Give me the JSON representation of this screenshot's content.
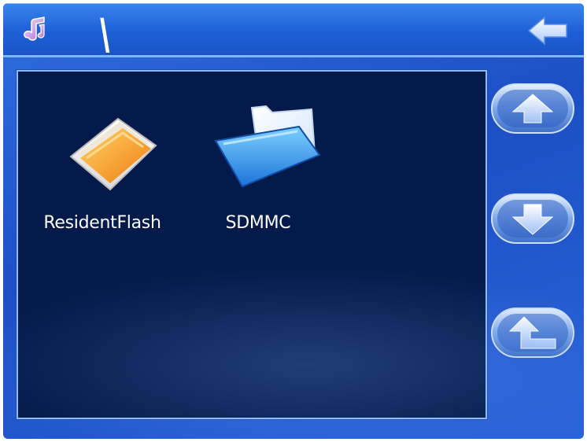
{
  "header": {
    "path_separator": "\\",
    "icons": {
      "left": "music-note-icon",
      "right": "back-arrow-icon"
    }
  },
  "files": {
    "items": [
      {
        "label": "ResidentFlash",
        "icon": "flash-folder-icon",
        "color": "#f59a1c"
      },
      {
        "label": "SDMMC",
        "icon": "sd-folder-icon",
        "color": "#3aa0f0"
      }
    ]
  },
  "sidebar": {
    "buttons": [
      {
        "name": "scroll-up",
        "icon": "arrow-up-icon"
      },
      {
        "name": "scroll-down",
        "icon": "arrow-down-icon"
      },
      {
        "name": "parent-directory",
        "icon": "return-up-icon"
      }
    ]
  },
  "colors": {
    "frame": "#1d4fc4",
    "pane": "#031a4a",
    "pane_border": "#8cbcff"
  }
}
